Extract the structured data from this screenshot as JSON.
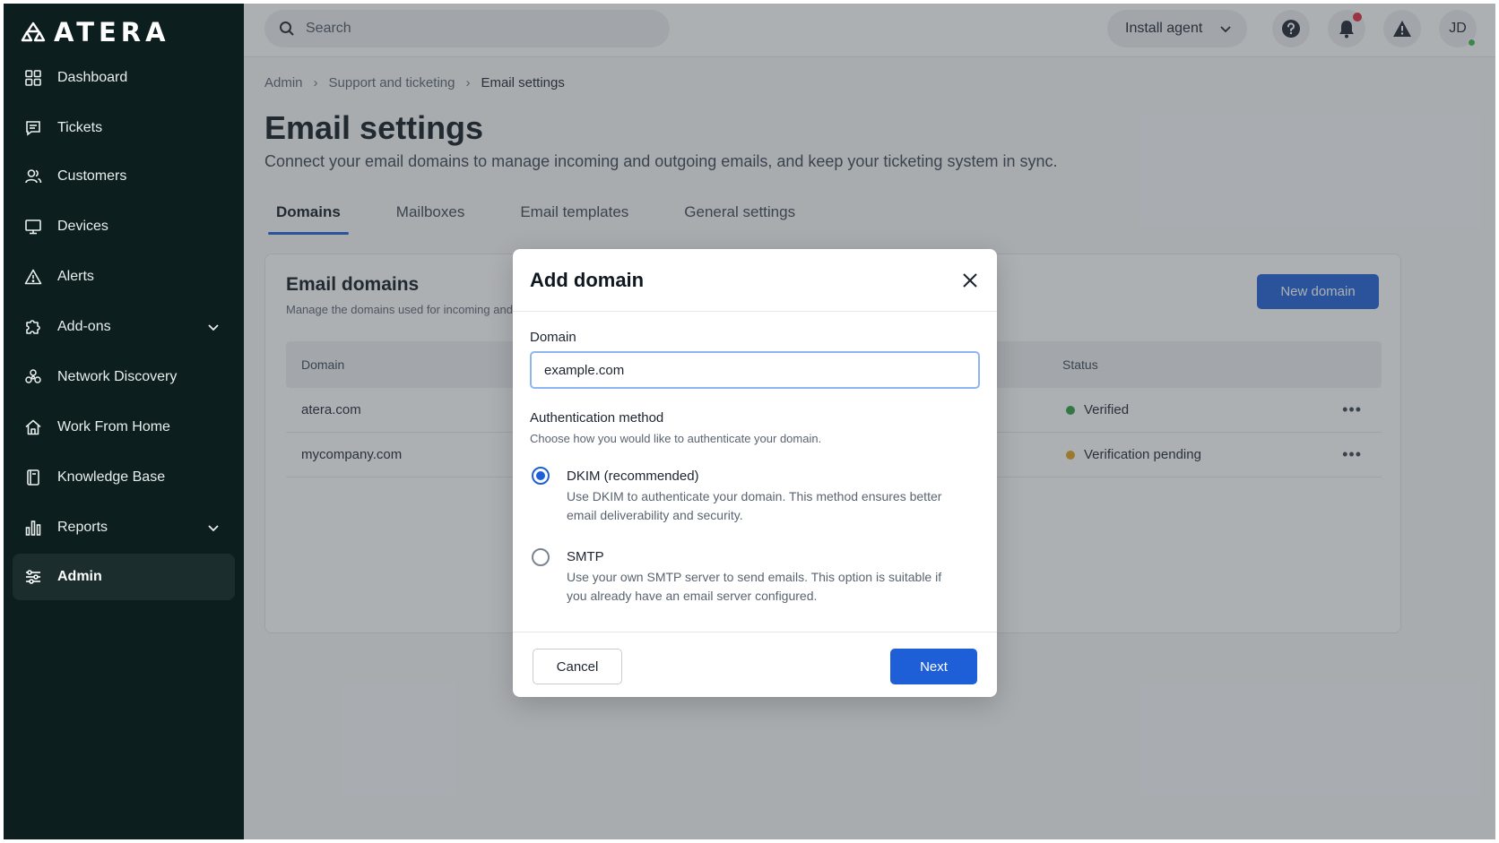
{
  "app": {
    "brand": "ATERA"
  },
  "sidebar": {
    "items": [
      {
        "label": "Dashboard",
        "icon": "dashboard-grid-icon"
      },
      {
        "label": "Tickets",
        "icon": "ticket-chat-icon"
      },
      {
        "label": "Customers",
        "icon": "users-icon"
      },
      {
        "label": "Devices",
        "icon": "monitor-icon"
      },
      {
        "label": "Alerts",
        "icon": "warning-icon"
      },
      {
        "label": "Add-ons",
        "icon": "puzzle-icon",
        "expandable": true
      },
      {
        "label": "Network Discovery",
        "icon": "network-icon"
      },
      {
        "label": "Work From Home",
        "icon": "home-icon"
      },
      {
        "label": "Knowledge Base",
        "icon": "book-icon"
      },
      {
        "label": "Reports",
        "icon": "bar-chart-icon",
        "expandable": true
      },
      {
        "label": "Admin",
        "icon": "sliders-icon",
        "active": true
      }
    ]
  },
  "topbar": {
    "search_placeholder": "Search",
    "install_agent": "Install agent",
    "avatar_initials": "JD"
  },
  "breadcrumb": [
    "Admin",
    "Support and ticketing",
    "Email settings"
  ],
  "page": {
    "title": "Email settings",
    "subtitle": "Connect your email domains to manage incoming and outgoing emails, and keep your ticketing system in sync."
  },
  "tabs": [
    {
      "label": "Domains",
      "active": true
    },
    {
      "label": "Mailboxes"
    },
    {
      "label": "Email templates"
    },
    {
      "label": "General settings"
    }
  ],
  "domains_card": {
    "title": "Email domains",
    "subtitle": "Manage the domains used for incoming and outgoing emails.",
    "new_button": "New domain",
    "columns": {
      "domain": "Domain",
      "status": "Status"
    },
    "rows": [
      {
        "domain": "atera.com",
        "status": "Verified",
        "status_color": "#2e9e44"
      },
      {
        "domain": "mycompany.com",
        "status": "Verification pending",
        "status_color": "#e0a21a"
      }
    ],
    "more_glyph": "•••"
  },
  "modal": {
    "title": "Add domain",
    "domain_label": "Domain",
    "domain_value": "example.com",
    "auth_label": "Authentication method",
    "auth_sub": "Choose how you would like to authenticate your domain.",
    "options": [
      {
        "title": "DKIM (recommended)",
        "desc": "Use DKIM to authenticate your domain. This method ensures better email deliverability and security.",
        "selected": true
      },
      {
        "title": "SMTP",
        "desc": "Use your own SMTP server to send emails. This option is suitable if you already have an email server configured.",
        "selected": false
      }
    ],
    "cancel": "Cancel",
    "next": "Next"
  },
  "colors": {
    "sidebar_bg": "#0d1e1e",
    "accent": "#1e5fd8",
    "notification_dot": "#e0283a",
    "online_dot": "#3fb950"
  }
}
